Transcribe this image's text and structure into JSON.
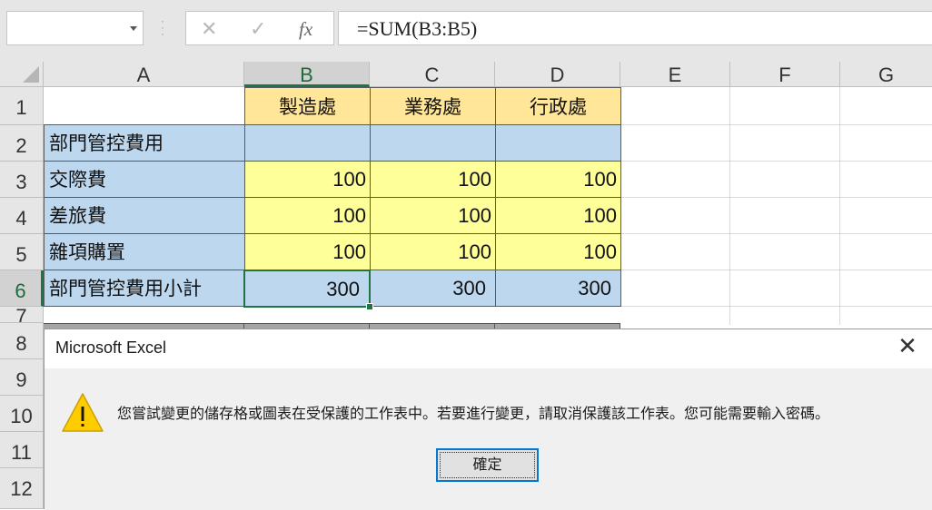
{
  "formula_bar": {
    "name_box": "",
    "cancel_icon": "✕",
    "enter_icon": "✓",
    "fx_label": "fx",
    "formula": "=SUM(B3:B5)"
  },
  "grid": {
    "columns": [
      "A",
      "B",
      "C",
      "D",
      "E",
      "F",
      "G"
    ],
    "rows": [
      "1",
      "2",
      "3",
      "4",
      "5",
      "6",
      "7",
      "8",
      "9",
      "10",
      "11",
      "12"
    ],
    "selected_column": "B",
    "selected_row": "6",
    "cells": {
      "B1": "製造處",
      "C1": "業務處",
      "D1": "行政處",
      "A2": "部門管控費用",
      "A3": "交際費",
      "B3": "100",
      "C3": "100",
      "D3": "100",
      "A4": "差旅費",
      "B4": "100",
      "C4": "100",
      "D4": "100",
      "A5": "雜項購置",
      "B5": "100",
      "C5": "100",
      "D5": "100",
      "A6": "部門管控費用小計",
      "B6": "300",
      "C6": "300",
      "D6": "300"
    },
    "colors": {
      "label_fill": "#bdd7ee",
      "header_fill": "#ffe699",
      "value_fill": "#ffff99",
      "selection": "#217346"
    }
  },
  "dialog": {
    "title": "Microsoft Excel",
    "close_icon": "✕",
    "icon": "warning-triangle-icon",
    "message": "您嘗試變更的儲存格或圖表在受保護的工作表中。若要進行變更，請取消保護該工作表。您可能需要輸入密碼。",
    "ok_label": "確定"
  }
}
